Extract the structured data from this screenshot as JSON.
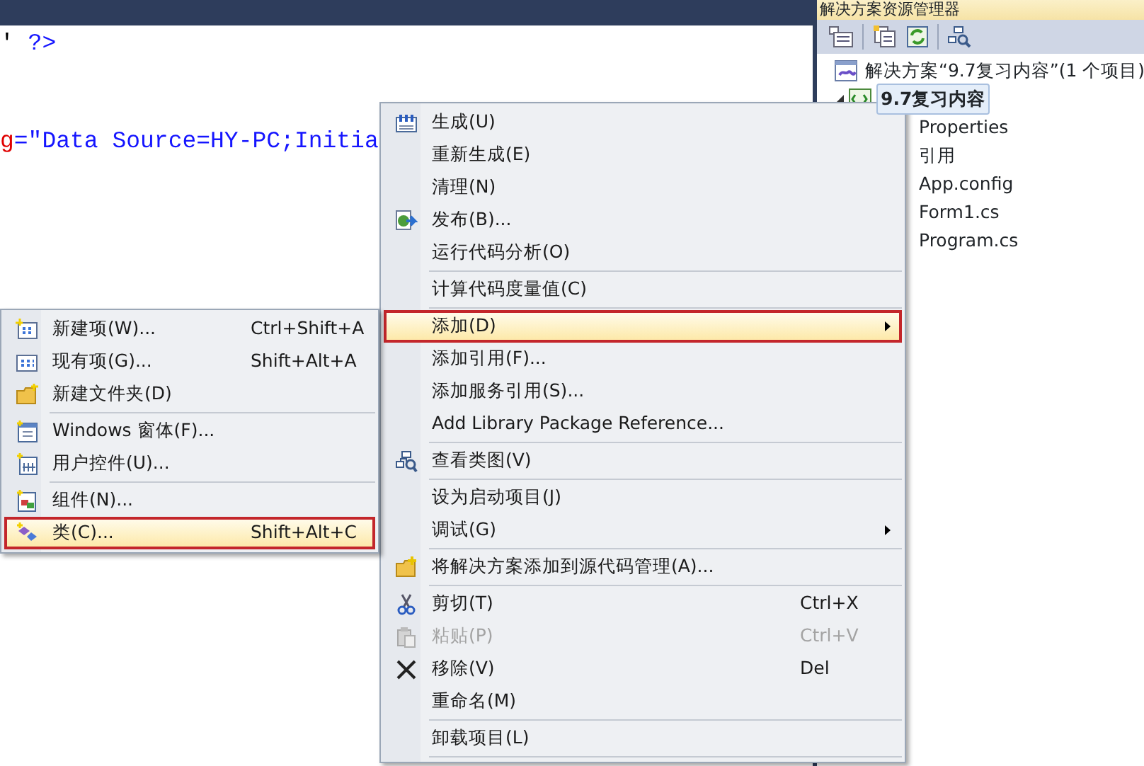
{
  "editor": {
    "lines": [
      {
        "tokens": [
          {
            "text": "'",
            "kind": "plain"
          },
          {
            "text": " ?>",
            "kind": "keyword"
          }
        ]
      },
      {
        "tokens": [
          {
            "text": "g",
            "kind": "attr"
          },
          {
            "text": "=\"Data Source=HY-PC;Initia",
            "kind": "string"
          }
        ]
      }
    ]
  },
  "solution_explorer": {
    "title": "解决方案资源管理器",
    "tree": [
      {
        "label": "解决方案“9.7复习内容”(1 个项目)",
        "selected": false,
        "children": [
          {
            "label": "9.7复习内容",
            "selected": true,
            "expanded": true,
            "children": [
              {
                "label": "Properties",
                "selected": false
              },
              {
                "label": "引用",
                "selected": false
              },
              {
                "label": "App.config",
                "selected": false
              },
              {
                "label": "Form1.cs",
                "selected": false
              },
              {
                "label": "Program.cs",
                "selected": false
              }
            ]
          }
        ]
      }
    ]
  },
  "context_menu": {
    "items": [
      {
        "kind": "item",
        "label": "生成(U)",
        "selected": false,
        "disabled": false,
        "has_submenu": false
      },
      {
        "kind": "item",
        "label": "重新生成(E)",
        "selected": false,
        "disabled": false,
        "has_submenu": false
      },
      {
        "kind": "item",
        "label": "清理(N)",
        "selected": false,
        "disabled": false,
        "has_submenu": false
      },
      {
        "kind": "item",
        "label": "发布(B)...",
        "selected": false,
        "disabled": false,
        "has_submenu": false
      },
      {
        "kind": "item",
        "label": "运行代码分析(O)",
        "selected": false,
        "disabled": false,
        "has_submenu": false
      },
      {
        "kind": "separator"
      },
      {
        "kind": "item",
        "label": "计算代码度量值(C)",
        "selected": false,
        "disabled": false,
        "has_submenu": false
      },
      {
        "kind": "separator"
      },
      {
        "kind": "item",
        "label": "添加(D)",
        "selected": true,
        "disabled": false,
        "has_submenu": true
      },
      {
        "kind": "item",
        "label": "添加引用(F)...",
        "selected": false,
        "disabled": false,
        "has_submenu": false
      },
      {
        "kind": "item",
        "label": "添加服务引用(S)...",
        "selected": false,
        "disabled": false,
        "has_submenu": false
      },
      {
        "kind": "item",
        "label": "Add Library Package Reference...",
        "selected": false,
        "disabled": false,
        "has_submenu": false
      },
      {
        "kind": "separator"
      },
      {
        "kind": "item",
        "label": "查看类图(V)",
        "selected": false,
        "disabled": false,
        "has_submenu": false
      },
      {
        "kind": "separator"
      },
      {
        "kind": "item",
        "label": "设为启动项目(J)",
        "selected": false,
        "disabled": false,
        "has_submenu": false
      },
      {
        "kind": "item",
        "label": "调试(G)",
        "selected": false,
        "disabled": false,
        "has_submenu": true
      },
      {
        "kind": "separator"
      },
      {
        "kind": "item",
        "label": "将解决方案添加到源代码管理(A)...",
        "selected": false,
        "disabled": false,
        "has_submenu": false
      },
      {
        "kind": "separator"
      },
      {
        "kind": "item",
        "label": "剪切(T)",
        "shortcut": "Ctrl+X",
        "selected": false,
        "disabled": false,
        "has_submenu": false
      },
      {
        "kind": "item",
        "label": "粘贴(P)",
        "shortcut": "Ctrl+V",
        "selected": false,
        "disabled": true,
        "has_submenu": false
      },
      {
        "kind": "item",
        "label": "移除(V)",
        "shortcut": "Del",
        "selected": false,
        "disabled": false,
        "has_submenu": false
      },
      {
        "kind": "item",
        "label": "重命名(M)",
        "selected": false,
        "disabled": false,
        "has_submenu": false
      },
      {
        "kind": "separator"
      },
      {
        "kind": "item",
        "label": "卸载项目(L)",
        "selected": false,
        "disabled": false,
        "has_submenu": false
      },
      {
        "kind": "separator"
      }
    ]
  },
  "submenu": {
    "items": [
      {
        "kind": "item",
        "label": "新建项(W)...",
        "shortcut": "Ctrl+Shift+A",
        "selected": false
      },
      {
        "kind": "item",
        "label": "现有项(G)...",
        "shortcut": "Shift+Alt+A",
        "selected": false
      },
      {
        "kind": "item",
        "label": "新建文件夹(D)",
        "selected": false
      },
      {
        "kind": "separator"
      },
      {
        "kind": "item",
        "label": "Windows 窗体(F)...",
        "selected": false
      },
      {
        "kind": "item",
        "label": "用户控件(U)...",
        "selected": false
      },
      {
        "kind": "separator"
      },
      {
        "kind": "item",
        "label": "组件(N)...",
        "selected": false
      },
      {
        "kind": "item",
        "label": "类(C)...",
        "shortcut": "Shift+Alt+C",
        "selected": true
      }
    ]
  }
}
